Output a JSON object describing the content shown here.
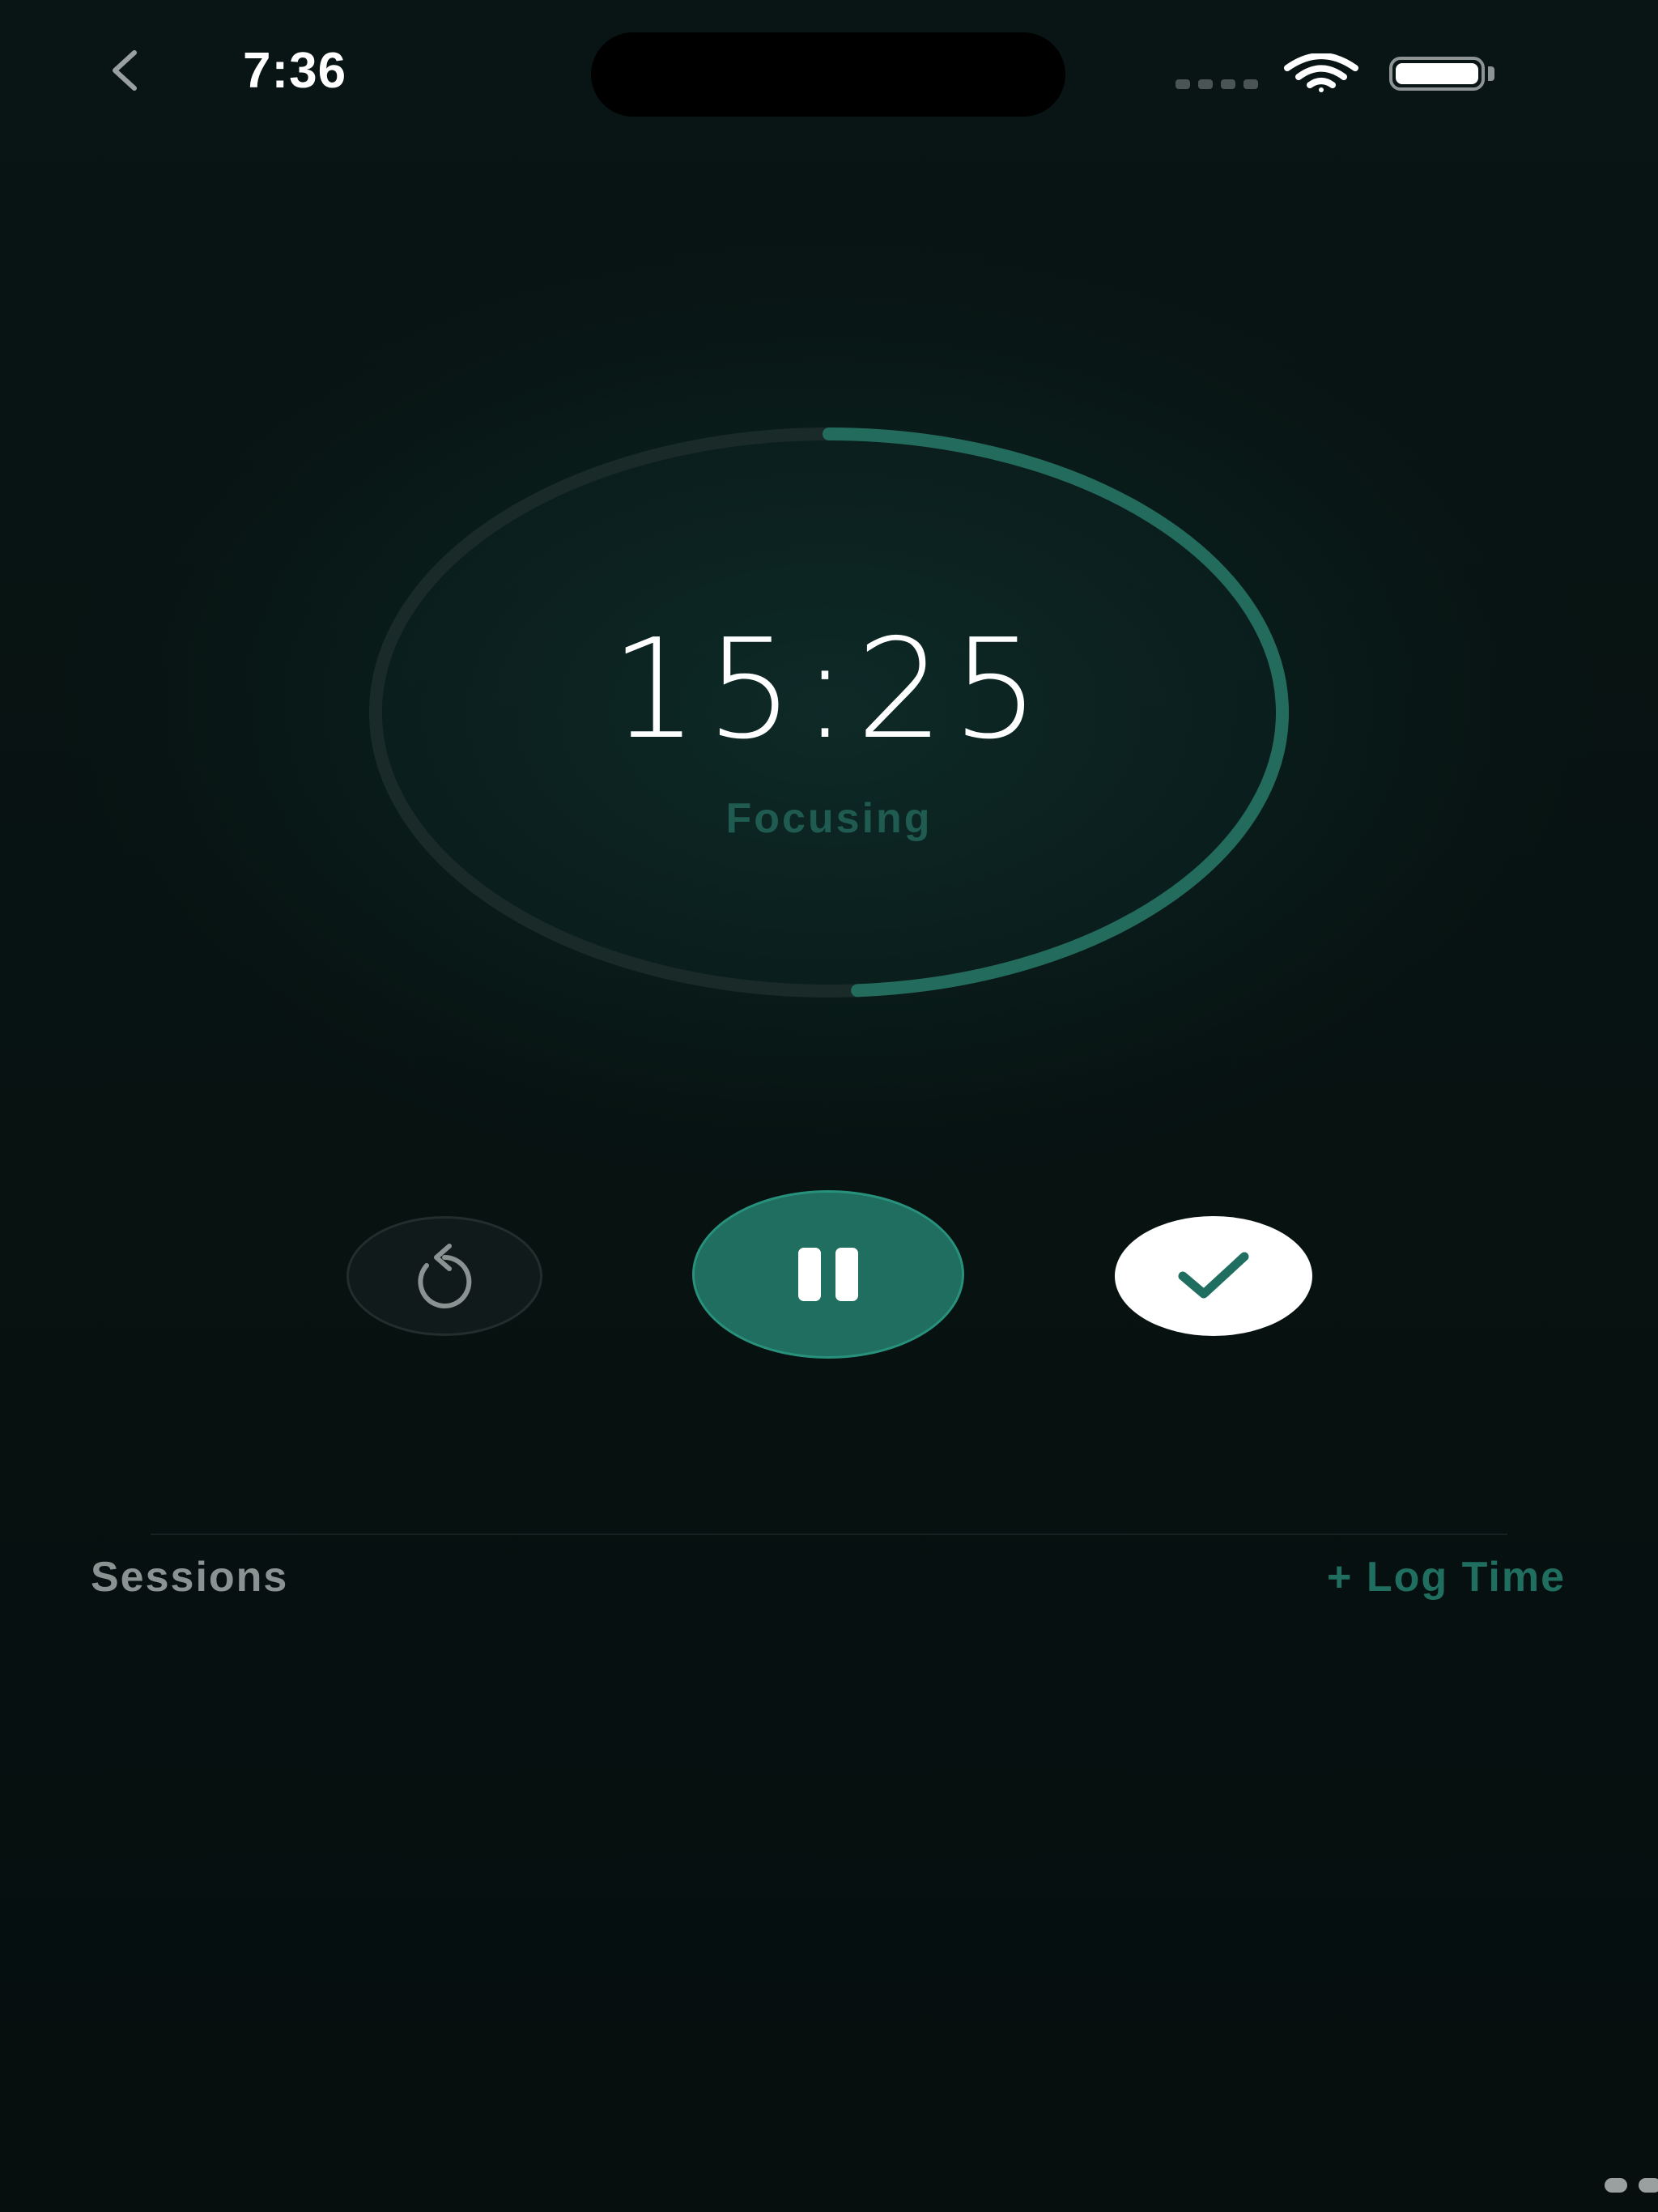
{
  "status_bar": {
    "time": "7:36",
    "icons": {
      "back": "chevron-left-icon",
      "cellular": "cellular-signal-icon",
      "wifi": "wifi-icon",
      "battery": "battery-icon"
    },
    "battery_level": 1.0
  },
  "timer": {
    "value": "15:25",
    "state_label": "Focusing",
    "progress": 0.49,
    "colors": {
      "progress": "#236b5d",
      "track": "#1a2a29",
      "state_text": "#1f5b50"
    }
  },
  "controls": {
    "reset_icon": "reset-icon",
    "pause_icon": "pause-icon",
    "complete_icon": "checkmark-icon",
    "colors": {
      "pause_bg": "#1f6e5f",
      "complete_bg": "#ffffff",
      "check": "#1f6e5f"
    }
  },
  "sessions": {
    "title": "Sessions",
    "log_time_label": "+ Log Time"
  },
  "colors": {
    "background": "#071211",
    "accent": "#1f6e5f"
  }
}
